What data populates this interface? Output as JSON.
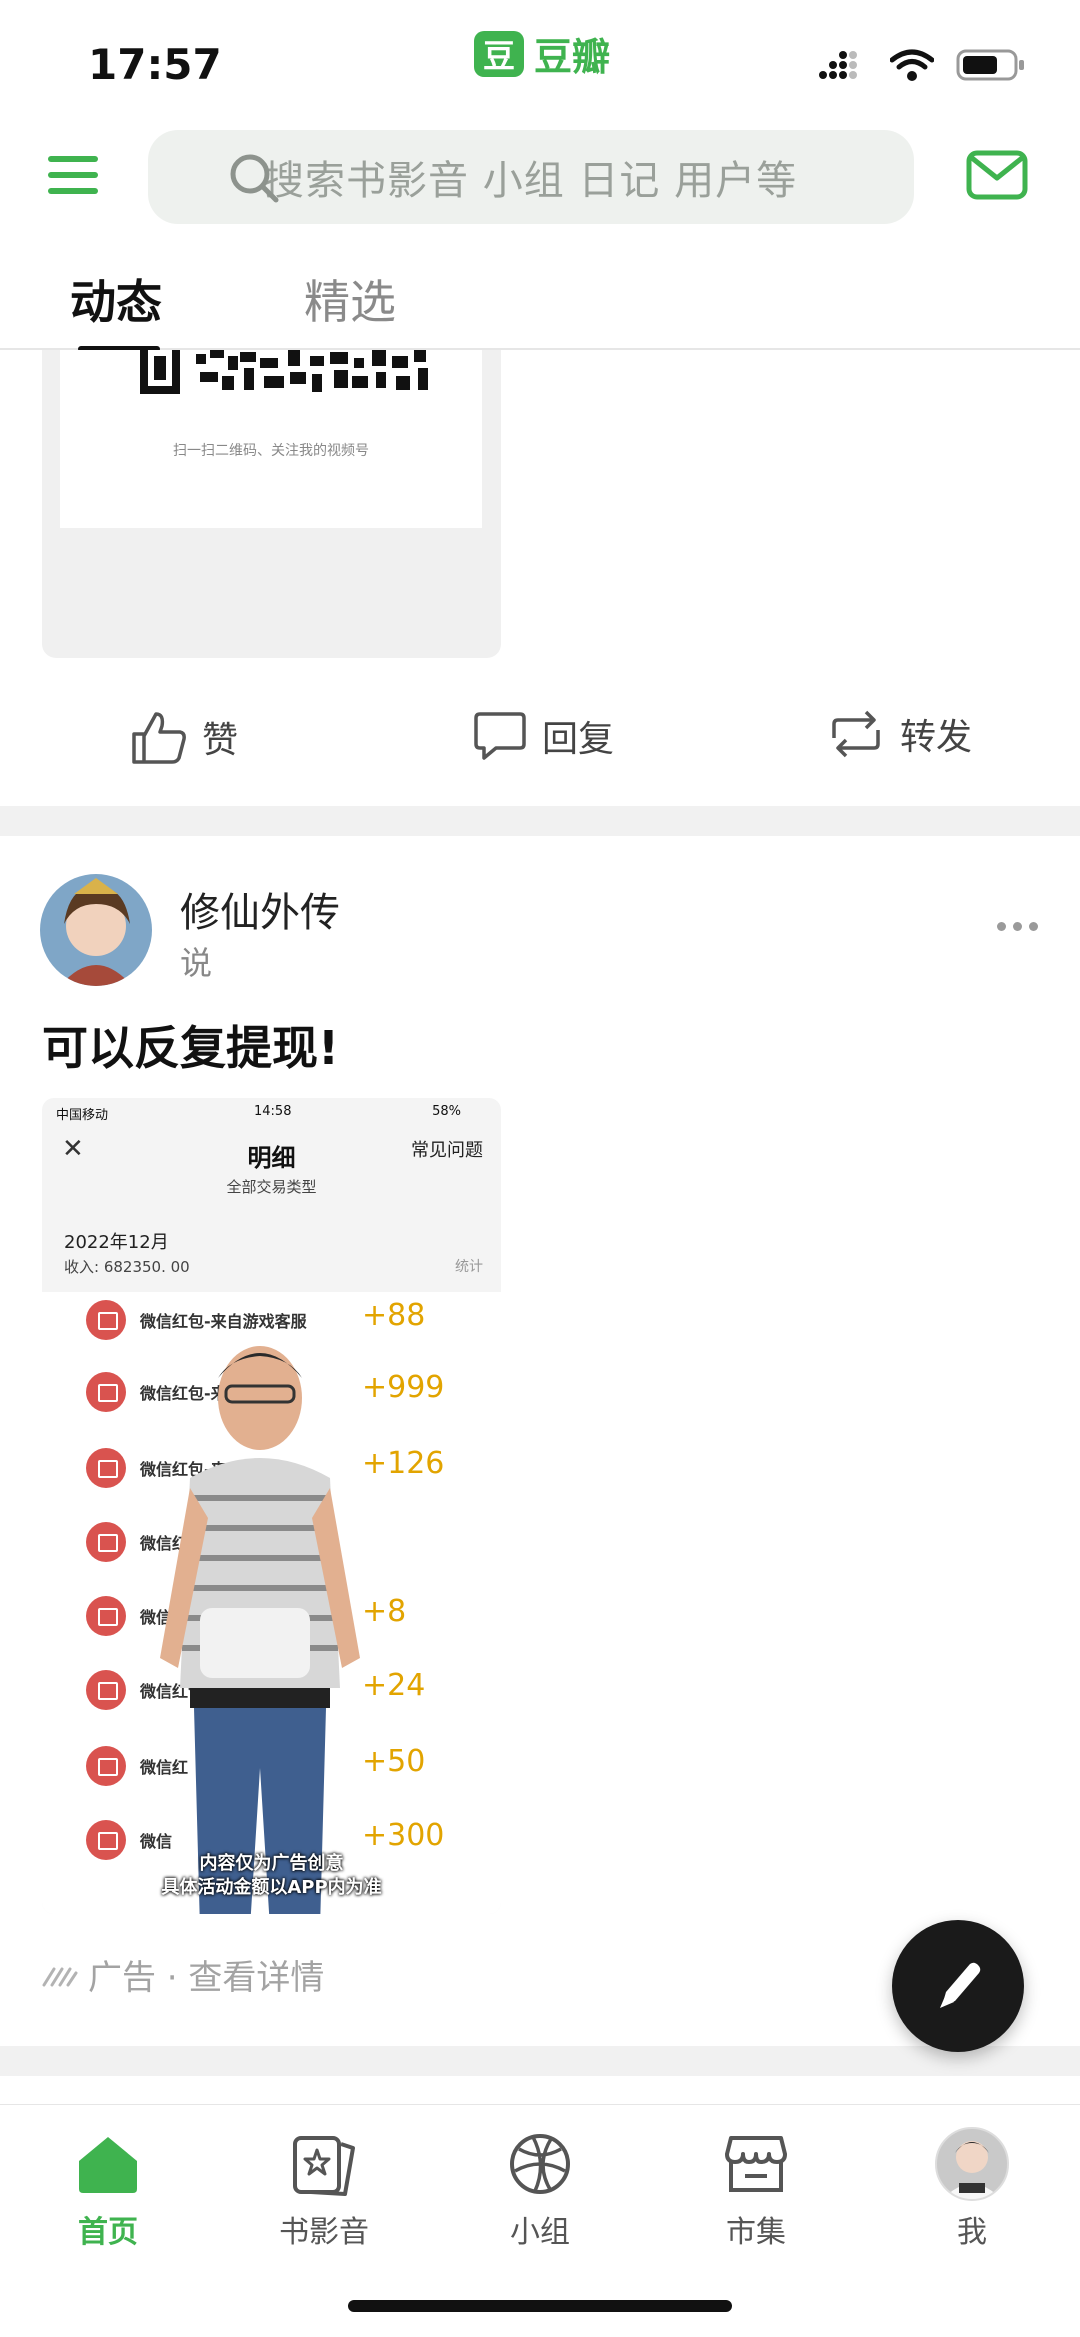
{
  "status_bar": {
    "time": "17:57",
    "app_name": "豆瓣",
    "logo_char": "豆"
  },
  "search": {
    "placeholder": "搜索书影音 小组 日记 用户等"
  },
  "tabs": [
    {
      "label": "动态",
      "active": true
    },
    {
      "label": "精选",
      "active": false
    }
  ],
  "qr_card": {
    "caption": "扫一扫二维码、关注我的视频号"
  },
  "actions": {
    "like": "赞",
    "reply": "回复",
    "repost": "转发"
  },
  "post": {
    "author": "修仙外传",
    "subtitle": "说",
    "text": "可以反复提现!",
    "image": {
      "carrier": "中国移动",
      "time": "14:58",
      "battery": "58%",
      "title": "明细",
      "faq": "常见问题",
      "filter": "全部交易类型",
      "month": "2022年12月",
      "income": "收入: 682350. 00",
      "stats": "统计",
      "rows": [
        {
          "title": "微信红包-来自游戏客服",
          "amount": "+88"
        },
        {
          "title": "微信红包-来自",
          "amount": "+999"
        },
        {
          "title": "微信红包-来自",
          "amount": "+126"
        },
        {
          "title": "微信红",
          "amount": ""
        },
        {
          "title": "微信红包",
          "amount": "+8"
        },
        {
          "title": "微信红包",
          "amount": "+24"
        },
        {
          "title": "微信红",
          "amount": "+50"
        },
        {
          "title": "微信",
          "amount": "+300"
        }
      ],
      "disclaimer_line1": "内容仅为广告创意",
      "disclaimer_line2": "具体活动金额以APP内为准"
    },
    "ad_label": "广告 · 查看详情"
  },
  "tabbar": [
    {
      "label": "首页",
      "icon": "home-icon",
      "active": true
    },
    {
      "label": "书影音",
      "icon": "book-movie-icon",
      "active": false
    },
    {
      "label": "小组",
      "icon": "group-icon",
      "active": false
    },
    {
      "label": "市集",
      "icon": "market-icon",
      "active": false
    },
    {
      "label": "我",
      "icon": "profile-avatar",
      "active": false
    }
  ],
  "colors": {
    "accent": "#3fb34f",
    "amount": "#e2a400",
    "redpacket": "#d9534f"
  }
}
